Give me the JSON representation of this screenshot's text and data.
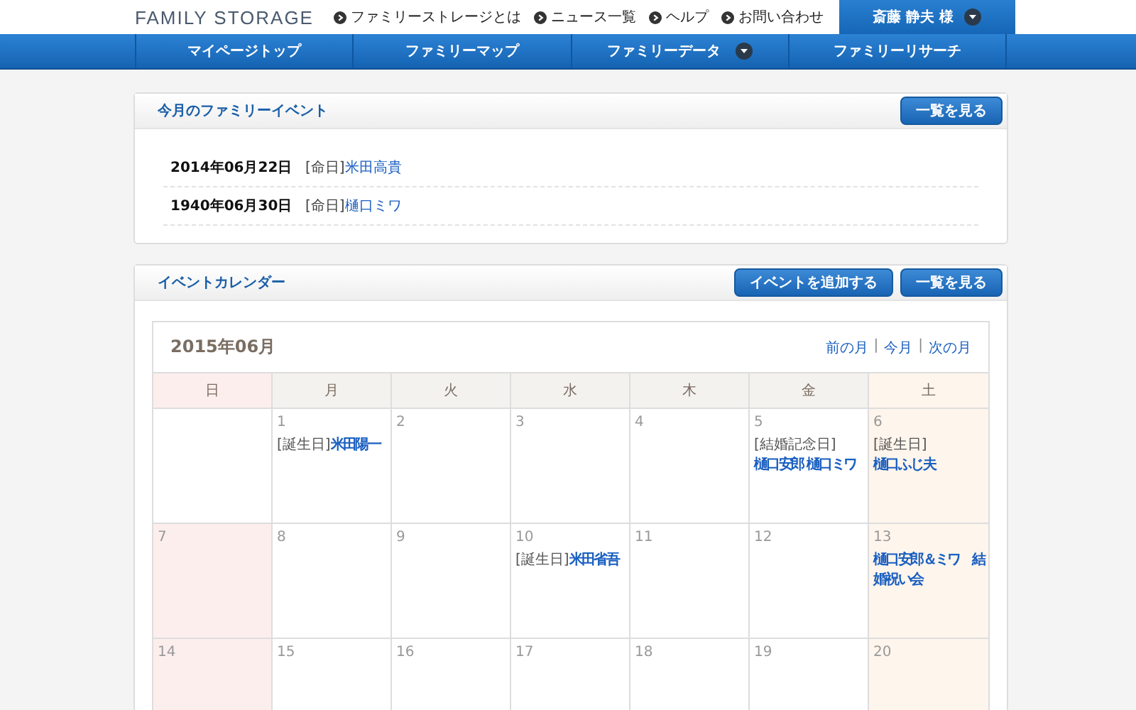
{
  "header": {
    "logo": "FAMILY STORAGE",
    "links": [
      "ファミリーストレージとは",
      "ニュース一覧",
      "ヘルプ",
      "お問い合わせ"
    ],
    "user": {
      "label": "斎藤 静夫 様",
      "dropdown": true
    }
  },
  "nav": [
    {
      "label": "マイページトップ",
      "dropdown": false
    },
    {
      "label": "ファミリーマップ",
      "dropdown": false
    },
    {
      "label": "ファミリーデータ",
      "dropdown": true
    },
    {
      "label": "ファミリーリサーチ",
      "dropdown": false
    }
  ],
  "family_events": {
    "title": "今月のファミリーイベント",
    "buttons": [
      "一覧を見る"
    ],
    "items": [
      {
        "date": "2014年06月22日",
        "tag": "[命日]",
        "name": "米田高貴"
      },
      {
        "date": "1940年06月30日",
        "tag": "[命日]",
        "name": "樋口ミワ"
      }
    ]
  },
  "event_calendar": {
    "title": "イベントカレンダー",
    "buttons": [
      "イベントを追加する",
      "一覧を見る"
    ],
    "month": "2015年06月",
    "month_nav": [
      {
        "kind": "link",
        "label": "前の月"
      },
      {
        "kind": "separator",
        "label": "|"
      },
      {
        "kind": "link",
        "label": "今月"
      },
      {
        "kind": "separator",
        "label": "|"
      },
      {
        "kind": "link",
        "label": "次の月"
      }
    ],
    "weekdays": [
      {
        "label": "日",
        "kind": "sunday"
      },
      {
        "label": "月",
        "kind": "weekday"
      },
      {
        "label": "火",
        "kind": "weekday"
      },
      {
        "label": "水",
        "kind": "weekday"
      },
      {
        "label": "木",
        "kind": "weekday"
      },
      {
        "label": "金",
        "kind": "weekday"
      },
      {
        "label": "土",
        "kind": "saturday"
      }
    ],
    "weeks": [
      [
        {
          "kind": "blank"
        },
        {
          "day": "1",
          "events": [
            {
              "tag": "[誕生日]",
              "name": "米田陽一"
            }
          ]
        },
        {
          "day": "2"
        },
        {
          "day": "3"
        },
        {
          "day": "4"
        },
        {
          "day": "5",
          "events": [
            {
              "tag": "[結婚記念日]",
              "name": "樋口安郎 樋口ミワ"
            }
          ]
        },
        {
          "day": "6",
          "events": [
            {
              "tag": "[誕生日]",
              "name": "樋口ふじ夫"
            }
          ]
        }
      ],
      [
        {
          "day": "7"
        },
        {
          "day": "8"
        },
        {
          "day": "9"
        },
        {
          "day": "10",
          "events": [
            {
              "tag": "[誕生日]",
              "name": "米田省吾"
            }
          ]
        },
        {
          "day": "11"
        },
        {
          "day": "12"
        },
        {
          "day": "13",
          "events": [
            {
              "name": "樋口安郎＆ミワ　結婚祝い会"
            }
          ]
        }
      ],
      [
        {
          "day": "14"
        },
        {
          "day": "15"
        },
        {
          "day": "16"
        },
        {
          "day": "17"
        },
        {
          "day": "18"
        },
        {
          "day": "19"
        },
        {
          "day": "20"
        }
      ]
    ]
  }
}
